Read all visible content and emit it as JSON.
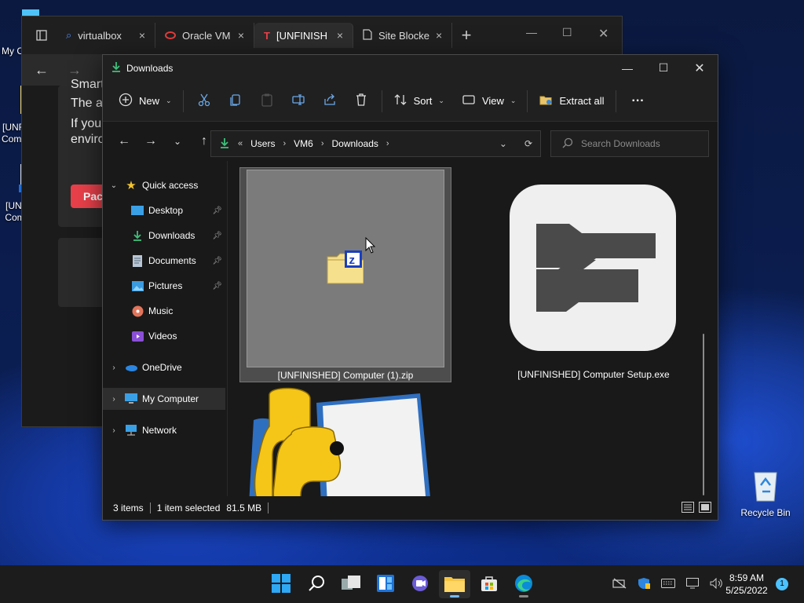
{
  "desktop": {
    "icons": [
      {
        "label": "My C",
        "icon": "computer-icon"
      },
      {
        "label": "[UNF Comp",
        "icon": "zip-folder-icon"
      },
      {
        "label": "[UNI Com",
        "icon": "shortcut-icon"
      }
    ],
    "recycle_bin": "Recycle Bin"
  },
  "browser": {
    "tabs": [
      {
        "label": "virtualbox",
        "icon": "search-icon"
      },
      {
        "label": "Oracle VM",
        "icon": "oracle-icon"
      },
      {
        "label": "[UNFINISH",
        "icon": "unfinished-icon"
      },
      {
        "label": "Site Blocke",
        "icon": "page-icon"
      }
    ],
    "content_lines": [
      "Smart",
      "The a",
      "If your",
      "enviro"
    ],
    "red_button": "Pac"
  },
  "explorer": {
    "title": "Downloads",
    "toolbar": {
      "new_label": "New",
      "sort_label": "Sort",
      "view_label": "View",
      "extract_label": "Extract all",
      "more_label": "···"
    },
    "address": {
      "overflow": "«",
      "crumbs": [
        "Users",
        "VM6",
        "Downloads"
      ]
    },
    "search_placeholder": "Search Downloads",
    "sidebar": {
      "quick_access": "Quick access",
      "items": [
        {
          "label": "Desktop",
          "icon": "desktop-icon",
          "pinned": true
        },
        {
          "label": "Downloads",
          "icon": "download-icon",
          "pinned": true
        },
        {
          "label": "Documents",
          "icon": "documents-icon",
          "pinned": true
        },
        {
          "label": "Pictures",
          "icon": "pictures-icon",
          "pinned": true
        },
        {
          "label": "Music",
          "icon": "music-icon",
          "pinned": false
        },
        {
          "label": "Videos",
          "icon": "videos-icon",
          "pinned": false
        }
      ],
      "onedrive": "OneDrive",
      "my_computer": "My Computer",
      "network": "Network"
    },
    "files": [
      {
        "name": "[UNFINISHED] Computer (1).zip",
        "selected": true
      },
      {
        "name": "[UNFINISHED] Computer Setup.exe",
        "selected": false
      },
      {
        "name": "",
        "selected": false
      }
    ],
    "status": {
      "items": "3 items",
      "selected": "1 item selected",
      "size": "81.5 MB"
    }
  },
  "taskbar": {
    "apps": [
      "start-icon",
      "search-icon",
      "task-view-icon",
      "widgets-icon",
      "teams-chat-icon",
      "file-explorer-icon",
      "store-icon",
      "edge-icon"
    ],
    "time": "8:59 AM",
    "date": "5/25/2022",
    "notification_count": "1"
  },
  "colors": {
    "accent": "#76b9ed",
    "selection": "#4d4d4d",
    "window_bg": "#191919"
  }
}
